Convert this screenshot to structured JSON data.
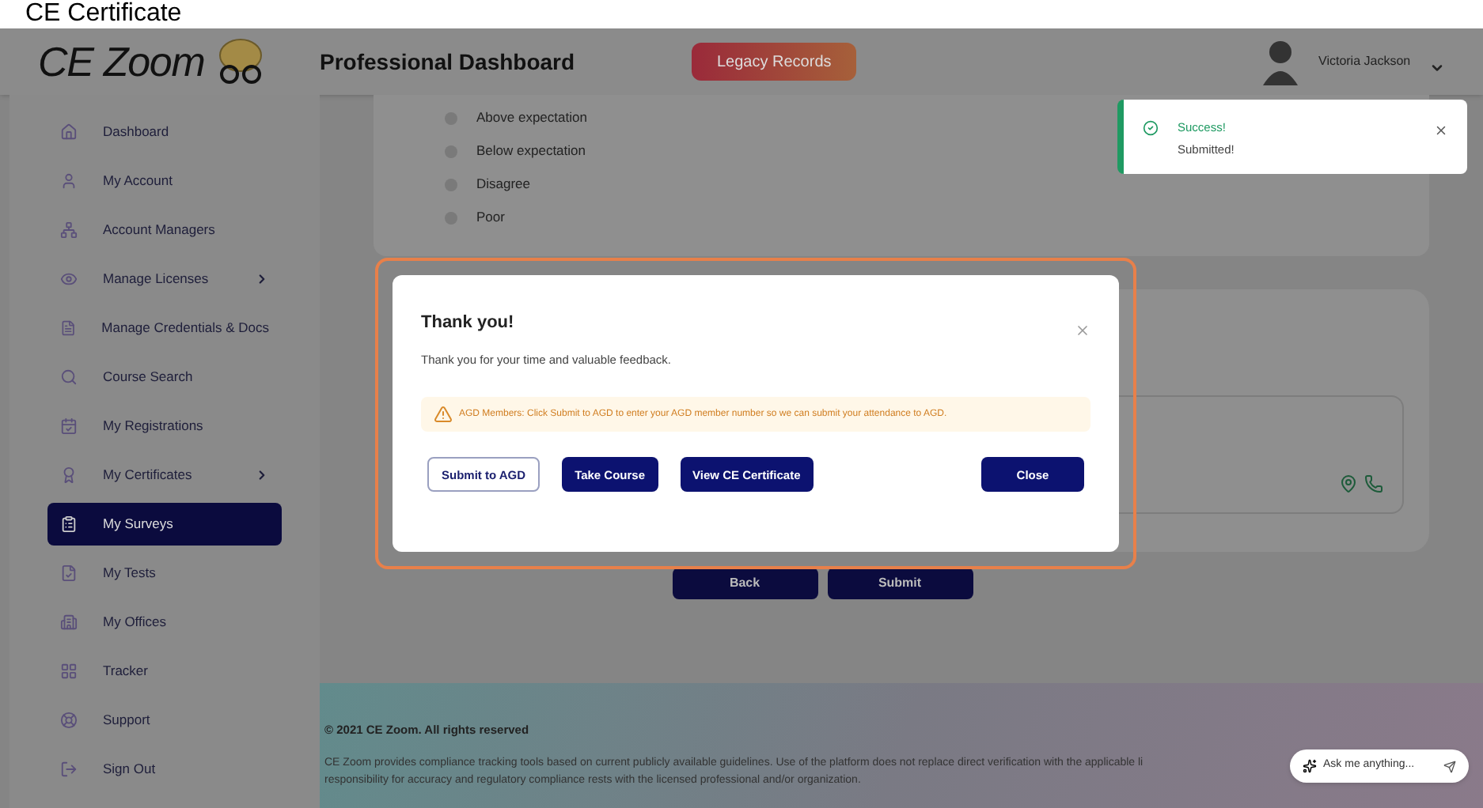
{
  "page_heading": "CE Certificate",
  "header": {
    "logo": "CE Zoom",
    "title": "Professional Dashboard",
    "legacy_button": "Legacy Records",
    "user_name": "Victoria Jackson"
  },
  "sidebar": {
    "items": [
      {
        "label": "Dashboard",
        "selected": false,
        "has_submenu": false
      },
      {
        "label": "My Account",
        "selected": false,
        "has_submenu": false
      },
      {
        "label": "Account Managers",
        "selected": false,
        "has_submenu": false
      },
      {
        "label": "Manage Licenses",
        "selected": false,
        "has_submenu": true
      },
      {
        "label": "Manage Credentials & Docs",
        "selected": false,
        "has_submenu": false
      },
      {
        "label": "Course Search",
        "selected": false,
        "has_submenu": false
      },
      {
        "label": "My Registrations",
        "selected": false,
        "has_submenu": false
      },
      {
        "label": "My Certificates",
        "selected": false,
        "has_submenu": true
      },
      {
        "label": "My Surveys",
        "selected": true,
        "has_submenu": false
      },
      {
        "label": "My Tests",
        "selected": false,
        "has_submenu": false
      },
      {
        "label": "My Offices",
        "selected": false,
        "has_submenu": false
      },
      {
        "label": "Tracker",
        "selected": false,
        "has_submenu": false
      },
      {
        "label": "Support",
        "selected": false,
        "has_submenu": false
      },
      {
        "label": "Sign Out",
        "selected": false,
        "has_submenu": false
      }
    ]
  },
  "survey": {
    "options": [
      {
        "label": "Above expectation",
        "checked": false
      },
      {
        "label": "Below expectation",
        "checked": false
      },
      {
        "label": "Disagree",
        "checked": false
      },
      {
        "label": "Poor",
        "checked": false
      }
    ],
    "buttons": [
      "Back",
      "Submit"
    ]
  },
  "modal": {
    "title": "Thank you!",
    "message": "Thank you for your time and valuable feedback.",
    "alert": "AGD Members: Click Submit to AGD to enter your AGD member number so we can submit your attendance to AGD.",
    "buttons": [
      {
        "label": "Submit to AGD",
        "kind": "outline"
      },
      {
        "label": "Take Course",
        "kind": "primary"
      },
      {
        "label": "View CE Certificate",
        "kind": "primary"
      },
      {
        "label": "Close",
        "kind": "primary"
      }
    ]
  },
  "toast": {
    "title": "Success!",
    "message": "Submitted!"
  },
  "footer": {
    "copyright": "© 2021 CE Zoom. All rights reserved",
    "disclaimer_line_1": "CE Zoom provides compliance tracking tools based on current publicly available guidelines. Use of the platform does not replace direct verification with the applicable li",
    "disclaimer_line_2": "responsibility for accuracy and regulatory compliance rests with the licensed professional and/or organization."
  },
  "chat": {
    "placeholder": "Ask me anything..."
  }
}
